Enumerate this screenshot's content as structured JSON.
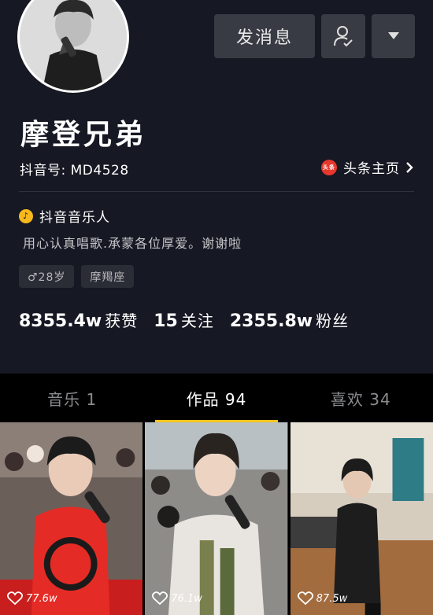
{
  "header": {
    "send_message_label": "发消息",
    "user_icon": "user-check-icon",
    "more_icon": "caret-down-icon"
  },
  "profile": {
    "name": "摩登兄弟",
    "douyin_id": "抖音号: MD4528",
    "toutiao_logo_text": "头条",
    "toutiao_link": "头条主页",
    "badge": "抖音音乐人",
    "bio": "用心认真唱歌.承蒙各位厚爱。谢谢啦",
    "tags": [
      "♂28岁",
      "摩羯座"
    ],
    "stats": [
      {
        "num": "8355.4w",
        "label": "获赞"
      },
      {
        "num": "15",
        "label": "关注"
      },
      {
        "num": "2355.8w",
        "label": "粉丝"
      }
    ]
  },
  "tabs": [
    {
      "label": "音乐 1",
      "active": false
    },
    {
      "label": "作品 94",
      "active": true
    },
    {
      "label": "喜欢 34",
      "active": false
    }
  ],
  "videos": [
    {
      "likes": "77.6w"
    },
    {
      "likes": "76.1w"
    },
    {
      "likes": "87.5w"
    }
  ],
  "colors": {
    "background": "#161823",
    "tab_indicator": "#f6c41d",
    "badge_gold": "#f6b81d",
    "toutiao_red": "#e8372d"
  }
}
